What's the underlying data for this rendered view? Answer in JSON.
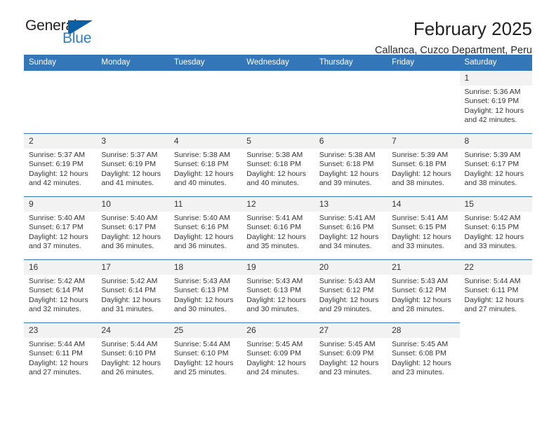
{
  "logo": {
    "word_one": "General",
    "word_two": "Blue",
    "mark": "triangle-flag",
    "colors": {
      "dark": "#231f20",
      "blue": "#2f7ec4",
      "mark_blue": "#0b5fa5"
    }
  },
  "header": {
    "title": "February 2025",
    "subtitle": "Callanca, Cuzco Department, Peru"
  },
  "theme": {
    "header_blue": "#3477b8",
    "daynum_band": "#f2f2f2",
    "text": "#333333"
  },
  "calendar": {
    "weekday_headers": [
      "Sunday",
      "Monday",
      "Tuesday",
      "Wednesday",
      "Thursday",
      "Friday",
      "Saturday"
    ],
    "labels": {
      "sunrise": "Sunrise:",
      "sunset": "Sunset:",
      "daylight": "Daylight:"
    },
    "weeks": [
      [
        {
          "day": "",
          "empty": true
        },
        {
          "day": "",
          "empty": true
        },
        {
          "day": "",
          "empty": true
        },
        {
          "day": "",
          "empty": true
        },
        {
          "day": "",
          "empty": true
        },
        {
          "day": "",
          "empty": true
        },
        {
          "day": "1",
          "sunrise": "Sunrise: 5:36 AM",
          "sunset": "Sunset: 6:19 PM",
          "daylight_1": "Daylight: 12 hours",
          "daylight_2": "and 42 minutes."
        }
      ],
      [
        {
          "day": "2",
          "sunrise": "Sunrise: 5:37 AM",
          "sunset": "Sunset: 6:19 PM",
          "daylight_1": "Daylight: 12 hours",
          "daylight_2": "and 42 minutes."
        },
        {
          "day": "3",
          "sunrise": "Sunrise: 5:37 AM",
          "sunset": "Sunset: 6:19 PM",
          "daylight_1": "Daylight: 12 hours",
          "daylight_2": "and 41 minutes."
        },
        {
          "day": "4",
          "sunrise": "Sunrise: 5:38 AM",
          "sunset": "Sunset: 6:18 PM",
          "daylight_1": "Daylight: 12 hours",
          "daylight_2": "and 40 minutes."
        },
        {
          "day": "5",
          "sunrise": "Sunrise: 5:38 AM",
          "sunset": "Sunset: 6:18 PM",
          "daylight_1": "Daylight: 12 hours",
          "daylight_2": "and 40 minutes."
        },
        {
          "day": "6",
          "sunrise": "Sunrise: 5:38 AM",
          "sunset": "Sunset: 6:18 PM",
          "daylight_1": "Daylight: 12 hours",
          "daylight_2": "and 39 minutes."
        },
        {
          "day": "7",
          "sunrise": "Sunrise: 5:39 AM",
          "sunset": "Sunset: 6:18 PM",
          "daylight_1": "Daylight: 12 hours",
          "daylight_2": "and 38 minutes."
        },
        {
          "day": "8",
          "sunrise": "Sunrise: 5:39 AM",
          "sunset": "Sunset: 6:17 PM",
          "daylight_1": "Daylight: 12 hours",
          "daylight_2": "and 38 minutes."
        }
      ],
      [
        {
          "day": "9",
          "sunrise": "Sunrise: 5:40 AM",
          "sunset": "Sunset: 6:17 PM",
          "daylight_1": "Daylight: 12 hours",
          "daylight_2": "and 37 minutes."
        },
        {
          "day": "10",
          "sunrise": "Sunrise: 5:40 AM",
          "sunset": "Sunset: 6:17 PM",
          "daylight_1": "Daylight: 12 hours",
          "daylight_2": "and 36 minutes."
        },
        {
          "day": "11",
          "sunrise": "Sunrise: 5:40 AM",
          "sunset": "Sunset: 6:16 PM",
          "daylight_1": "Daylight: 12 hours",
          "daylight_2": "and 36 minutes."
        },
        {
          "day": "12",
          "sunrise": "Sunrise: 5:41 AM",
          "sunset": "Sunset: 6:16 PM",
          "daylight_1": "Daylight: 12 hours",
          "daylight_2": "and 35 minutes."
        },
        {
          "day": "13",
          "sunrise": "Sunrise: 5:41 AM",
          "sunset": "Sunset: 6:16 PM",
          "daylight_1": "Daylight: 12 hours",
          "daylight_2": "and 34 minutes."
        },
        {
          "day": "14",
          "sunrise": "Sunrise: 5:41 AM",
          "sunset": "Sunset: 6:15 PM",
          "daylight_1": "Daylight: 12 hours",
          "daylight_2": "and 33 minutes."
        },
        {
          "day": "15",
          "sunrise": "Sunrise: 5:42 AM",
          "sunset": "Sunset: 6:15 PM",
          "daylight_1": "Daylight: 12 hours",
          "daylight_2": "and 33 minutes."
        }
      ],
      [
        {
          "day": "16",
          "sunrise": "Sunrise: 5:42 AM",
          "sunset": "Sunset: 6:14 PM",
          "daylight_1": "Daylight: 12 hours",
          "daylight_2": "and 32 minutes."
        },
        {
          "day": "17",
          "sunrise": "Sunrise: 5:42 AM",
          "sunset": "Sunset: 6:14 PM",
          "daylight_1": "Daylight: 12 hours",
          "daylight_2": "and 31 minutes."
        },
        {
          "day": "18",
          "sunrise": "Sunrise: 5:43 AM",
          "sunset": "Sunset: 6:13 PM",
          "daylight_1": "Daylight: 12 hours",
          "daylight_2": "and 30 minutes."
        },
        {
          "day": "19",
          "sunrise": "Sunrise: 5:43 AM",
          "sunset": "Sunset: 6:13 PM",
          "daylight_1": "Daylight: 12 hours",
          "daylight_2": "and 30 minutes."
        },
        {
          "day": "20",
          "sunrise": "Sunrise: 5:43 AM",
          "sunset": "Sunset: 6:12 PM",
          "daylight_1": "Daylight: 12 hours",
          "daylight_2": "and 29 minutes."
        },
        {
          "day": "21",
          "sunrise": "Sunrise: 5:43 AM",
          "sunset": "Sunset: 6:12 PM",
          "daylight_1": "Daylight: 12 hours",
          "daylight_2": "and 28 minutes."
        },
        {
          "day": "22",
          "sunrise": "Sunrise: 5:44 AM",
          "sunset": "Sunset: 6:11 PM",
          "daylight_1": "Daylight: 12 hours",
          "daylight_2": "and 27 minutes."
        }
      ],
      [
        {
          "day": "23",
          "sunrise": "Sunrise: 5:44 AM",
          "sunset": "Sunset: 6:11 PM",
          "daylight_1": "Daylight: 12 hours",
          "daylight_2": "and 27 minutes."
        },
        {
          "day": "24",
          "sunrise": "Sunrise: 5:44 AM",
          "sunset": "Sunset: 6:10 PM",
          "daylight_1": "Daylight: 12 hours",
          "daylight_2": "and 26 minutes."
        },
        {
          "day": "25",
          "sunrise": "Sunrise: 5:44 AM",
          "sunset": "Sunset: 6:10 PM",
          "daylight_1": "Daylight: 12 hours",
          "daylight_2": "and 25 minutes."
        },
        {
          "day": "26",
          "sunrise": "Sunrise: 5:45 AM",
          "sunset": "Sunset: 6:09 PM",
          "daylight_1": "Daylight: 12 hours",
          "daylight_2": "and 24 minutes."
        },
        {
          "day": "27",
          "sunrise": "Sunrise: 5:45 AM",
          "sunset": "Sunset: 6:09 PM",
          "daylight_1": "Daylight: 12 hours",
          "daylight_2": "and 23 minutes."
        },
        {
          "day": "28",
          "sunrise": "Sunrise: 5:45 AM",
          "sunset": "Sunset: 6:08 PM",
          "daylight_1": "Daylight: 12 hours",
          "daylight_2": "and 23 minutes."
        },
        {
          "day": "",
          "empty": true
        }
      ]
    ]
  }
}
